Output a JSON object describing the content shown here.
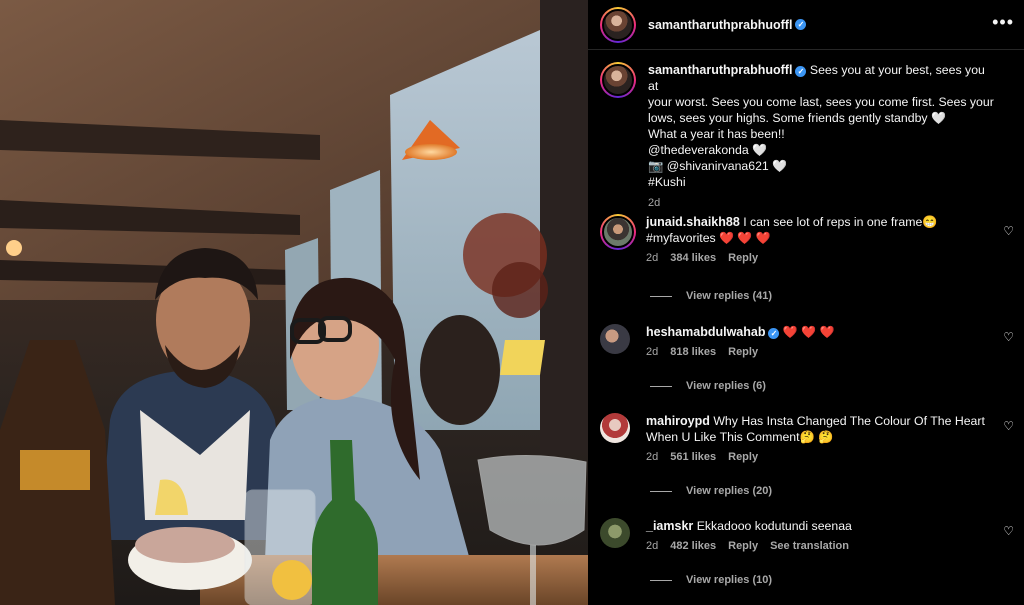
{
  "post": {
    "author": "samantharuthprabhuoffl",
    "verified_icon": "verified-badge-icon",
    "more_icon": "more-options-icon",
    "caption_lines": [
      "Sees you at your best, sees you at",
      "your worst. Sees you come last, sees you come first. Sees your",
      "lows, sees your highs. Some friends gently standby",
      "What a year it has been!!",
      "@thedeverakonda",
      "@shivanirvana621",
      "#Kushi"
    ],
    "caption_emojis": {
      "heart": "🤍",
      "camera": "📷"
    },
    "time": "2d"
  },
  "comments": [
    {
      "username": "junaid.shaikh88",
      "text_line1": "I can see lot of reps in one frame😁",
      "text_line2": "#myfavorites",
      "hearts": "❤️ ❤️ ❤️",
      "time": "2d",
      "likes": "384 likes",
      "reply": "Reply",
      "view_replies": "View replies (41)"
    },
    {
      "username": "heshamabdulwahab",
      "text": "",
      "hearts": "❤️ ❤️ ❤️",
      "time": "2d",
      "likes": "818 likes",
      "reply": "Reply",
      "view_replies": "View replies (6)"
    },
    {
      "username": "mahiroypd",
      "text_line1": "Why Has Insta Changed The Colour Of The Heart",
      "text_line2": "When U Like This Comment🤔 🤔",
      "time": "2d",
      "likes": "561 likes",
      "reply": "Reply",
      "view_replies": "View replies (20)"
    },
    {
      "username": "_iamskr",
      "text": "Ekkadooo kodutundi seenaa",
      "time": "2d",
      "likes": "482 likes",
      "reply": "Reply",
      "see_translation": "See translation",
      "view_replies": "View replies (10)"
    }
  ],
  "icons": {
    "like": "heart-outline-icon"
  },
  "colors": {
    "background": "#000000",
    "text": "#f5f5f5",
    "muted": "#a8a8a8",
    "verified": "#3b95f3"
  }
}
